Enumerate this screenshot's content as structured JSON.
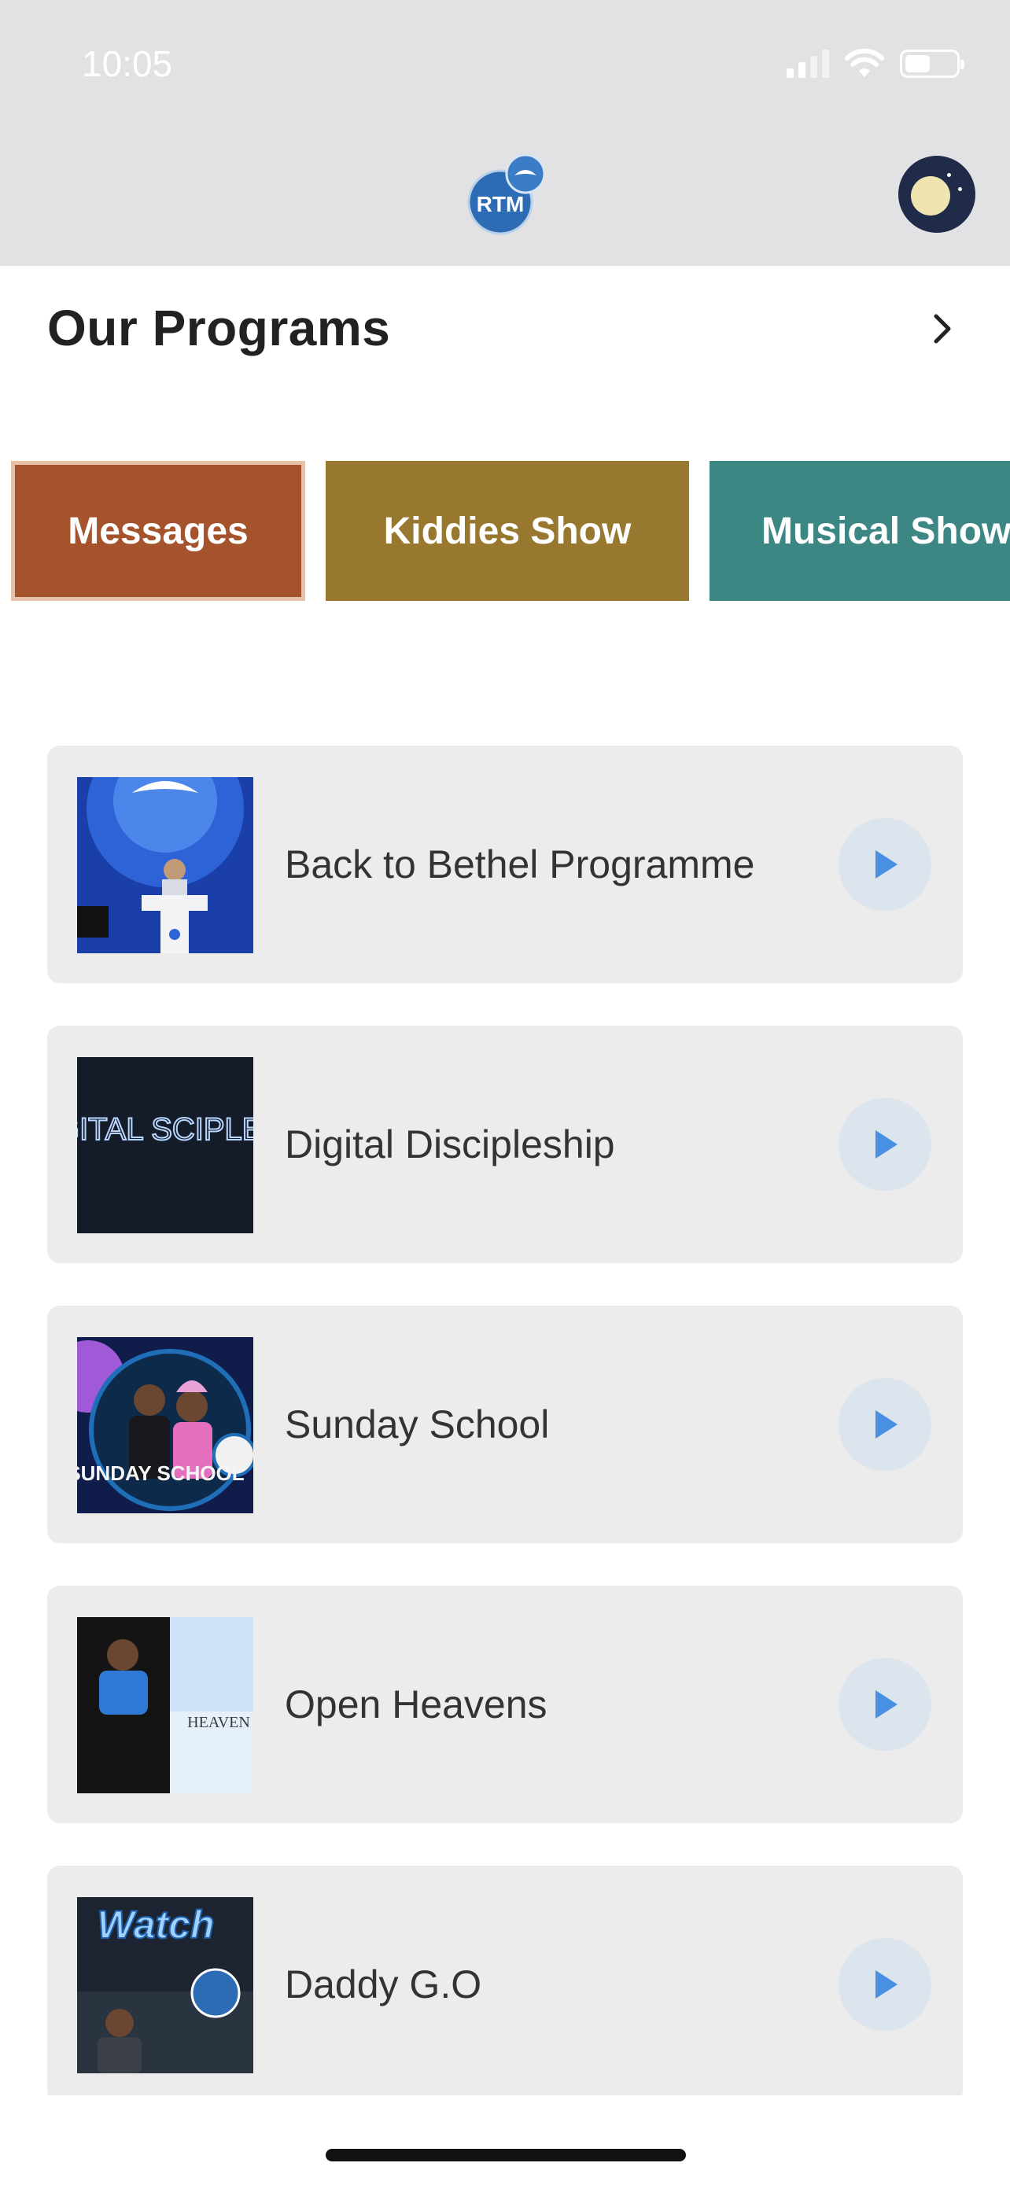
{
  "status_bar": {
    "time": "10:05"
  },
  "header": {
    "logo_text": "RTM"
  },
  "section": {
    "title": "Our Programs"
  },
  "categories": [
    {
      "label": "Messages",
      "selected": true
    },
    {
      "label": "Kiddies Show",
      "selected": false
    },
    {
      "label": "Musical Show",
      "selected": false
    }
  ],
  "programs": [
    {
      "title": "Back to Bethel Programme",
      "thumb_caption": ""
    },
    {
      "title": "Digital Discipleship",
      "thumb_caption": "DIGITAL SCIPLESH"
    },
    {
      "title": "Sunday School",
      "thumb_caption": "SUNDAY SCHOOL"
    },
    {
      "title": "Open Heavens",
      "thumb_caption": "HEAVEN"
    },
    {
      "title": "Daddy G.O",
      "thumb_caption": "Watch"
    }
  ],
  "colors": {
    "messages_chip": "#a5532c",
    "kiddies_chip": "#98782e",
    "musical_chip": "#3c8684",
    "play_icon": "#4a90e2"
  }
}
